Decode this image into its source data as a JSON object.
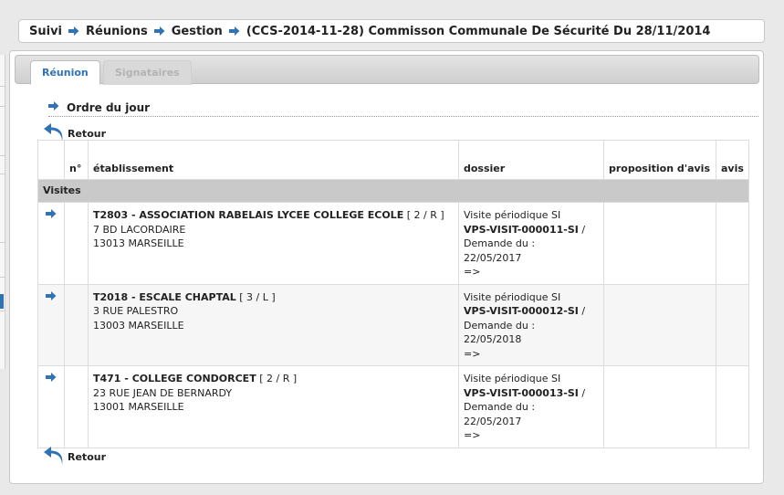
{
  "breadcrumb": {
    "items": [
      "Suivi",
      "Réunions",
      "Gestion",
      "(CCS-2014-11-28) Commisson Communale De Sécurité Du 28/11/2014"
    ]
  },
  "tabs": [
    {
      "label": "Réunion",
      "active": true
    },
    {
      "label": "Signataires",
      "active": false
    }
  ],
  "section": {
    "title": "Ordre du jour"
  },
  "retour_label": "Retour",
  "table": {
    "headers": {
      "arrow": "",
      "num": "n°",
      "etablissement": "établissement",
      "dossier": "dossier",
      "proposition": "proposition d'avis",
      "avis": "avis"
    },
    "group_label": "Visites",
    "rows": [
      {
        "num": "",
        "etab_code_name": "T2803 - ASSOCIATION RABELAIS LYCEE COLLEGE ECOLE",
        "etab_badge": "[ 2 / R ]",
        "address1": "7 BD LACORDAIRE",
        "address2": "13013 MARSEILLE",
        "dossier_type": "Visite périodique SI",
        "dossier_num": "VPS-VISIT-000011-SI",
        "dossier_sep": "/",
        "dossier_demande": "Demande du :",
        "dossier_date": "22/05/2017",
        "dossier_arrow": "=>",
        "proposition": "",
        "avis": ""
      },
      {
        "num": "",
        "etab_code_name": "T2018 - ESCALE CHAPTAL",
        "etab_badge": "[ 3 / L ]",
        "address1": "3 RUE PALESTRO",
        "address2": "13003 MARSEILLE",
        "dossier_type": "Visite périodique SI",
        "dossier_num": "VPS-VISIT-000012-SI",
        "dossier_sep": "/",
        "dossier_demande": "Demande du :",
        "dossier_date": "22/05/2018",
        "dossier_arrow": "=>",
        "proposition": "",
        "avis": ""
      },
      {
        "num": "",
        "etab_code_name": "T471 - COLLEGE CONDORCET",
        "etab_badge": "[ 2 / R ]",
        "address1": "23 RUE JEAN DE BERNARDY",
        "address2": "13001 MARSEILLE",
        "dossier_type": "Visite périodique SI",
        "dossier_num": "VPS-VISIT-000013-SI",
        "dossier_sep": "/",
        "dossier_demande": "Demande du :",
        "dossier_date": "22/05/2017",
        "dossier_arrow": "=>",
        "proposition": "",
        "avis": ""
      }
    ]
  },
  "icons": {
    "breadcrumb_separator": "arrow-right-icon",
    "row_link": "arrow-right-icon",
    "retour": "back-arrow-icon"
  },
  "colors": {
    "accent": "#2f73b5",
    "group_header_bg": "#c9c9c9"
  }
}
